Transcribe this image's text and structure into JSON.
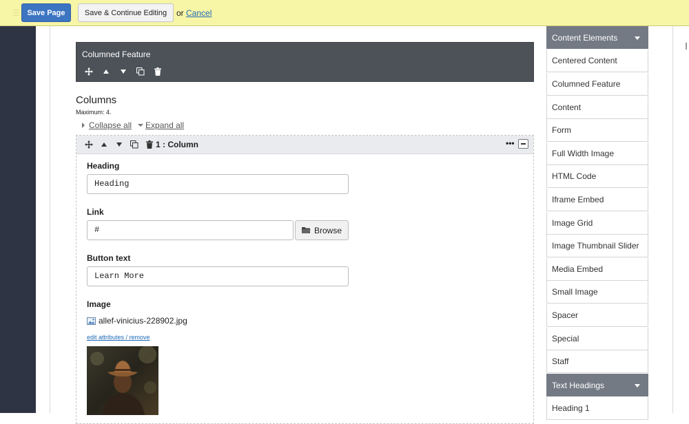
{
  "toolbar": {
    "save_page": "Save Page",
    "save_continue": "Save & Continue Editing",
    "or_text": "or",
    "cancel": "Cancel"
  },
  "block": {
    "title": "Columned Feature"
  },
  "columns": {
    "title": "Columns",
    "maximum": "Maximum: 4.",
    "collapse_all": "Collapse all",
    "expand_all": "Expand all",
    "column_title": "1 : Column",
    "more": "•••"
  },
  "fields": {
    "heading_label": "Heading",
    "heading_value": "Heading",
    "link_label": "Link",
    "link_value": "#",
    "browse": "Browse",
    "button_text_label": "Button text",
    "button_text_value": "Learn More",
    "image_label": "Image",
    "image_file": "allef-vinicius-228902.jpg",
    "edit_attributes": "edit attributes / remove"
  },
  "sidebar": {
    "categories": [
      "Content Elements",
      "Text Headings"
    ],
    "content_elements": [
      "Centered Content",
      "Columned Feature",
      "Content",
      "Form",
      "Full Width Image",
      "HTML Code",
      "Iframe Embed",
      "Image Grid",
      "Image Thumbnail Slider",
      "Media Embed",
      "Small Image",
      "Spacer",
      "Special",
      "Staff"
    ],
    "text_headings": [
      "Heading 1"
    ]
  },
  "colors": {
    "toolbar_bg": "#f7f5a6",
    "primary_button": "#3c75c2",
    "block_header": "#4d5259",
    "sidebar_category": "#737a84",
    "left_rail": "#2f3444",
    "link": "#1f6ab8"
  }
}
